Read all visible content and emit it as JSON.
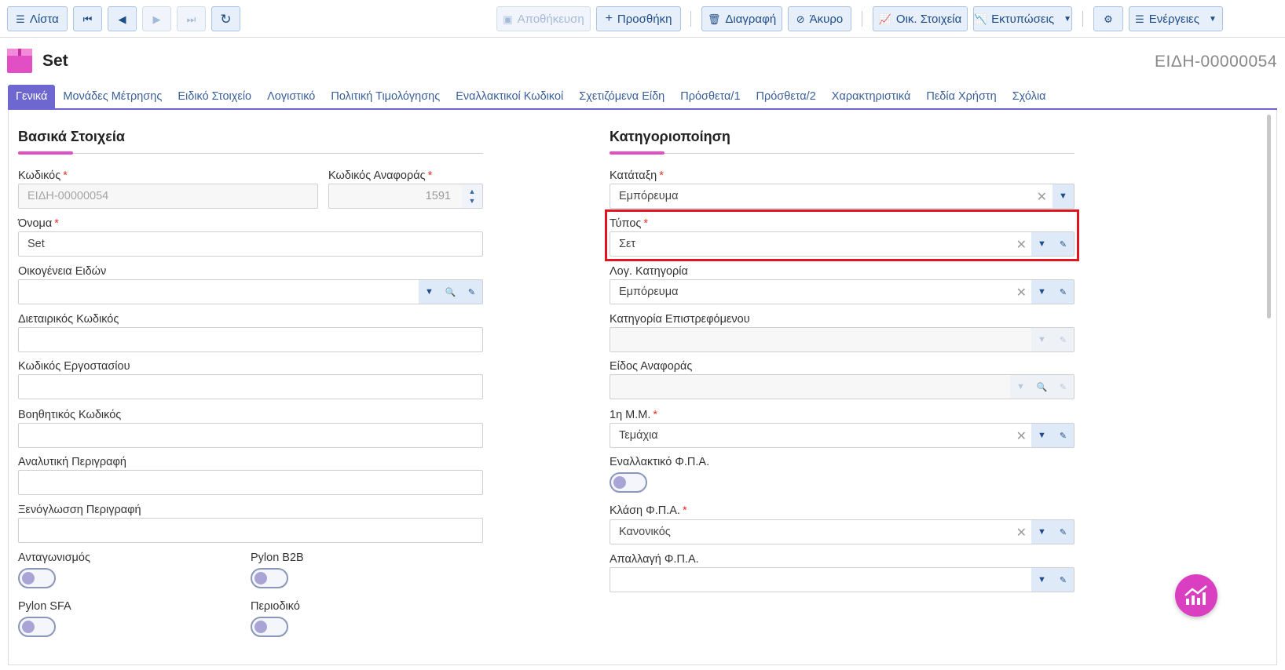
{
  "toolbar": {
    "list": "Λίστα",
    "save": "Αποθήκευση",
    "add": "Προσθήκη",
    "delete": "Διαγραφή",
    "cancel": "Άκυρο",
    "financials": "Οικ. Στοιχεία",
    "prints": "Εκτυπώσεις",
    "actions": "Ενέργειες"
  },
  "header": {
    "title": "Set",
    "code": "ΕΙΔΗ-00000054"
  },
  "tabs": [
    "Γενικά",
    "Μονάδες Μέτρησης",
    "Ειδικό Στοιχείο",
    "Λογιστικό",
    "Πολιτική Τιμολόγησης",
    "Εναλλακτικοί Κωδικοί",
    "Σχετιζόμενα Είδη",
    "Πρόσθετα/1",
    "Πρόσθετα/2",
    "Χαρακτηριστικά",
    "Πεδία Χρήστη",
    "Σχόλια"
  ],
  "left": {
    "title": "Βασικά Στοιχεία",
    "code_label": "Κωδικός",
    "code_value": "ΕΙΔΗ-00000054",
    "ref_label": "Κωδικός Αναφοράς",
    "ref_value": "1591",
    "name_label": "Όνομα",
    "name_value": "Set",
    "family_label": "Οικογένεια Ειδών",
    "intl_label": "Διεταιρικός Κωδικός",
    "factory_label": "Κωδικός Εργοστασίου",
    "aux_label": "Βοηθητικός Κωδικός",
    "desc_label": "Αναλυτική Περιγραφή",
    "foreign_label": "Ξενόγλωσση Περιγραφή",
    "competition_label": "Ανταγωνισμός",
    "b2b_label": "Pylon B2B",
    "sfa_label": "Pylon SFA",
    "periodic_label": "Περιοδικό"
  },
  "right": {
    "title": "Κατηγοριοποίηση",
    "class_label": "Κατάταξη",
    "class_value": "Εμπόρευμα",
    "type_label": "Τύπος",
    "type_value": "Σετ",
    "acc_label": "Λογ. Κατηγορία",
    "acc_value": "Εμπόρευμα",
    "return_label": "Κατηγορία Επιστρεφόμενου",
    "reftype_label": "Είδος Αναφοράς",
    "uom_label": "1η Μ.Μ.",
    "uom_value": "Τεμάχια",
    "altvat_label": "Εναλλακτικό Φ.Π.Α.",
    "vatclass_label": "Κλάση Φ.Π.Α.",
    "vatclass_value": "Κανονικός",
    "vatexempt_label": "Απαλλαγή Φ.Π.Α."
  },
  "colors": {
    "accent": "#6e67cf",
    "pink": "#e24ec3",
    "highlight": "#e0141f"
  }
}
